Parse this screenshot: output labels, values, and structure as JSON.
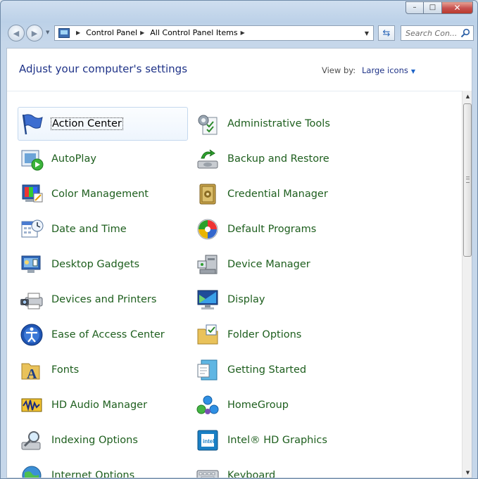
{
  "window": {
    "caption": {
      "minimize": "–",
      "maximize": "□",
      "close": "✕"
    }
  },
  "nav": {
    "back_icon": "back-arrow-icon",
    "forward_icon": "forward-arrow-icon",
    "breadcrumbs": [
      "Control Panel",
      "All Control Panel Items"
    ],
    "search_placeholder": "Search Con..."
  },
  "header": {
    "title": "Adjust your computer's settings",
    "view_by_label": "View by:",
    "view_by_value": "Large icons"
  },
  "items": [
    {
      "label": "Action Center",
      "icon": "action-center-flag-icon",
      "selected": true
    },
    {
      "label": "Administrative Tools",
      "icon": "administrative-tools-icon"
    },
    {
      "label": "AutoPlay",
      "icon": "autoplay-icon"
    },
    {
      "label": "Backup and Restore",
      "icon": "backup-restore-icon"
    },
    {
      "label": "Color Management",
      "icon": "color-management-icon"
    },
    {
      "label": "Credential Manager",
      "icon": "credential-vault-icon"
    },
    {
      "label": "Date and Time",
      "icon": "calendar-clock-icon"
    },
    {
      "label": "Default Programs",
      "icon": "default-programs-icon"
    },
    {
      "label": "Desktop Gadgets",
      "icon": "desktop-gadgets-icon"
    },
    {
      "label": "Device Manager",
      "icon": "device-manager-icon"
    },
    {
      "label": "Devices and Printers",
      "icon": "printer-camera-icon"
    },
    {
      "label": "Display",
      "icon": "monitor-icon"
    },
    {
      "label": "Ease of Access Center",
      "icon": "ease-of-access-icon"
    },
    {
      "label": "Folder Options",
      "icon": "folder-options-icon"
    },
    {
      "label": "Fonts",
      "icon": "fonts-folder-icon"
    },
    {
      "label": "Getting Started",
      "icon": "getting-started-icon"
    },
    {
      "label": "HD Audio Manager",
      "icon": "audio-manager-icon"
    },
    {
      "label": "HomeGroup",
      "icon": "homegroup-icon"
    },
    {
      "label": "Indexing Options",
      "icon": "indexing-options-icon"
    },
    {
      "label": "Intel® HD Graphics",
      "icon": "intel-graphics-icon"
    },
    {
      "label": "Internet Options",
      "icon": "internet-options-icon"
    },
    {
      "label": "Keyboard",
      "icon": "keyboard-icon"
    }
  ]
}
